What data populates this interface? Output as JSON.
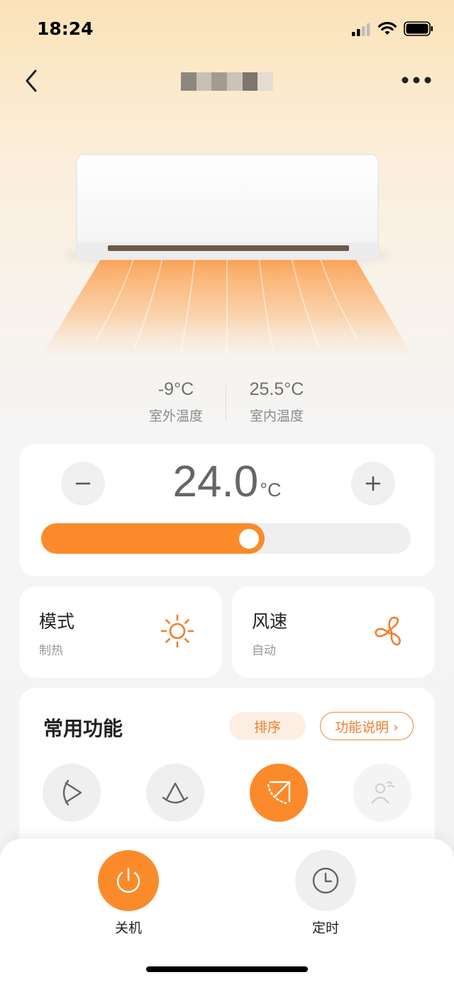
{
  "status_bar": {
    "time": "18:24"
  },
  "colors": {
    "accent": "#fb8a2a",
    "accent_light": "#fdeee3",
    "text_dark": "#222222",
    "text_muted": "#999999",
    "card_bg": "#ffffff",
    "control_bg": "#efefef"
  },
  "header": {
    "title_obscured": true,
    "icons": [
      "back-icon",
      "more-icon"
    ]
  },
  "climate": {
    "outdoor": {
      "value": "-9°C",
      "label": "室外温度"
    },
    "indoor": {
      "value": "25.5°C",
      "label": "室内温度"
    }
  },
  "setpoint": {
    "value": "24.0",
    "unit": "°C",
    "slider_fraction": 0.605
  },
  "tiles": [
    {
      "title": "模式",
      "subtitle": "制热",
      "icon": "sun-icon"
    },
    {
      "title": "风速",
      "subtitle": "自动",
      "icon": "fan-icon"
    }
  ],
  "functions": {
    "title": "常用功能",
    "sort_label": "排序",
    "help_label": "功能说明 ›",
    "items": [
      {
        "icon": "swing-horizontal-icon",
        "active": false
      },
      {
        "icon": "swing-vertical-icon",
        "active": false
      },
      {
        "icon": "swing-diagonal-icon",
        "active": true
      },
      {
        "icon": "avoid-person-icon",
        "active": false,
        "disabled": true
      }
    ]
  },
  "bottom_bar": {
    "power": {
      "label": "关机",
      "icon": "power-icon"
    },
    "timer": {
      "label": "定时",
      "icon": "clock-icon"
    }
  }
}
